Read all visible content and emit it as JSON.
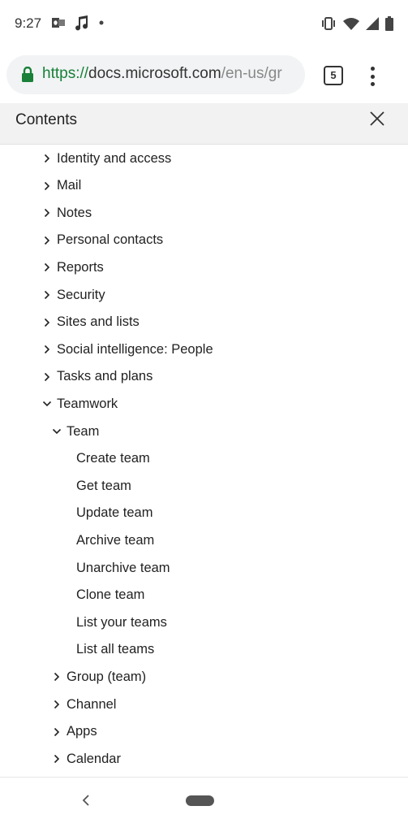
{
  "status": {
    "time": "9:27",
    "left_icons": [
      "outlook-icon",
      "music-note-icon",
      "dot-icon"
    ],
    "right_icons": [
      "vibrate-icon",
      "wifi-icon",
      "signal-icon",
      "battery-icon"
    ]
  },
  "browser": {
    "url_scheme": "https://",
    "url_host": "docs.microsoft.com",
    "url_path": "/en-us/gr",
    "tab_count": "5"
  },
  "contents": {
    "title": "Contents"
  },
  "toc": {
    "items": [
      {
        "label": "Identity and access",
        "state": "collapsed",
        "level": 1
      },
      {
        "label": "Mail",
        "state": "collapsed",
        "level": 1
      },
      {
        "label": "Notes",
        "state": "collapsed",
        "level": 1
      },
      {
        "label": "Personal contacts",
        "state": "collapsed",
        "level": 1
      },
      {
        "label": "Reports",
        "state": "collapsed",
        "level": 1
      },
      {
        "label": "Security",
        "state": "collapsed",
        "level": 1
      },
      {
        "label": "Sites and lists",
        "state": "collapsed",
        "level": 1
      },
      {
        "label": "Social intelligence: People",
        "state": "collapsed",
        "level": 1
      },
      {
        "label": "Tasks and plans",
        "state": "collapsed",
        "level": 1
      },
      {
        "label": "Teamwork",
        "state": "expanded",
        "level": 1
      },
      {
        "label": "Team",
        "state": "expanded",
        "level": 2
      },
      {
        "label": "Create team",
        "state": "leaf",
        "level": 3
      },
      {
        "label": "Get team",
        "state": "leaf",
        "level": 3
      },
      {
        "label": "Update team",
        "state": "leaf",
        "level": 3
      },
      {
        "label": "Archive team",
        "state": "leaf",
        "level": 3
      },
      {
        "label": "Unarchive team",
        "state": "leaf",
        "level": 3
      },
      {
        "label": "Clone team",
        "state": "leaf",
        "level": 3
      },
      {
        "label": "List your teams",
        "state": "leaf",
        "level": 3
      },
      {
        "label": "List all teams",
        "state": "leaf",
        "level": 3
      },
      {
        "label": "Group (team)",
        "state": "collapsed",
        "level": 2
      },
      {
        "label": "Channel",
        "state": "collapsed",
        "level": 2
      },
      {
        "label": "Apps",
        "state": "collapsed",
        "level": 2
      },
      {
        "label": "Calendar",
        "state": "collapsed",
        "level": 2
      }
    ]
  },
  "colors": {
    "url_scheme": "#188038",
    "text": "#222222",
    "header_bg": "#f2f2f2"
  }
}
